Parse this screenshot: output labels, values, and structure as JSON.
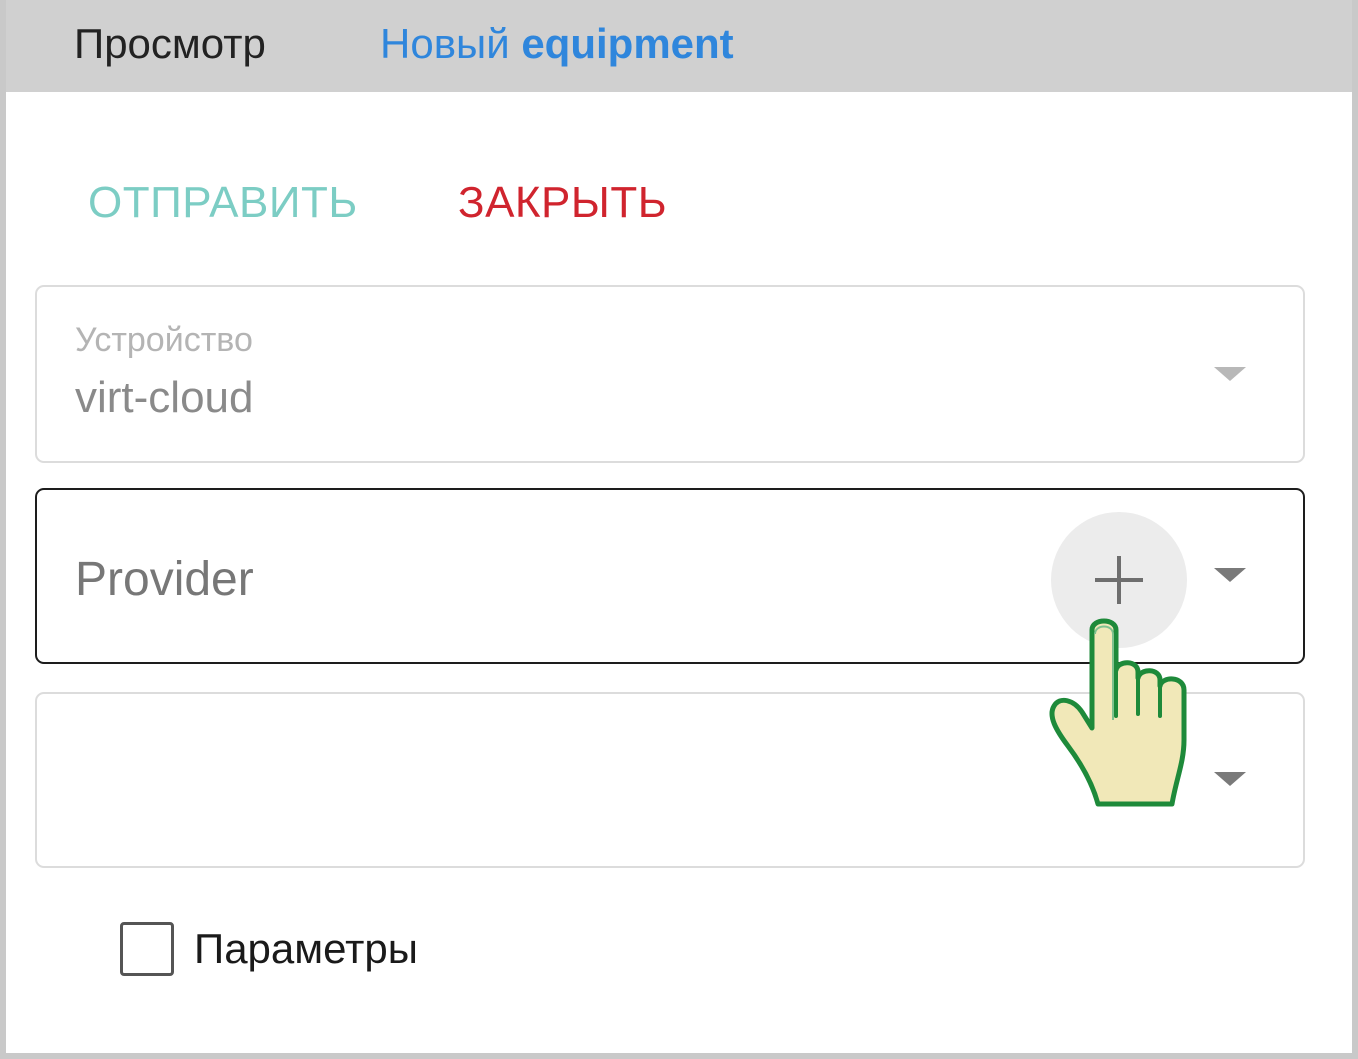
{
  "header": {
    "tabs": [
      {
        "label": "Просмотр"
      },
      {
        "label_prefix": "Новый",
        "label_strong": "equipment"
      }
    ]
  },
  "actions": {
    "send_label": "ОТПРАВИТЬ",
    "close_label": "ЗАКРЫТЬ"
  },
  "form": {
    "device": {
      "label": "Устройство",
      "value": "virt-cloud"
    },
    "provider": {
      "placeholder": "Provider"
    },
    "third": {
      "value": ""
    },
    "parameters": {
      "label": "Параметры",
      "checked": false
    }
  },
  "icons": {
    "add": "plus-icon",
    "dropdown": "chevron-down-icon",
    "cursor": "hand-pointer-icon"
  },
  "colors": {
    "send": "#7ccdc4",
    "close": "#d0242e",
    "tab_active": "#2f86dc",
    "cursor_fill": "#f1e8b8",
    "cursor_outline": "#1e8a3a"
  }
}
